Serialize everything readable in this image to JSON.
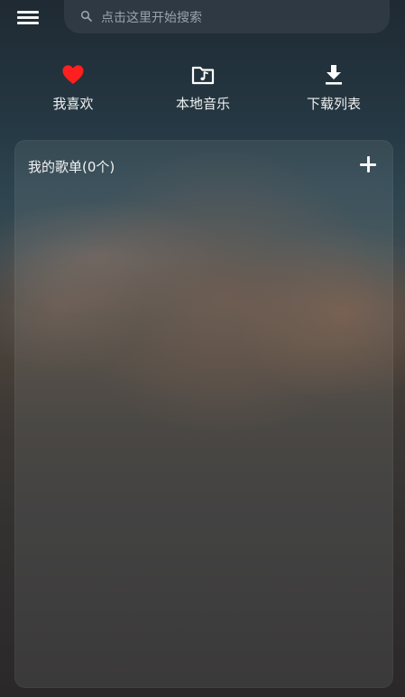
{
  "search": {
    "placeholder": "点击这里开始搜索",
    "icon": "search-icon"
  },
  "menu": {
    "icon": "hamburger-menu-icon"
  },
  "quick_links": [
    {
      "label": "我喜欢",
      "icon": "heart-icon",
      "color": "#ff1f1f"
    },
    {
      "label": "本地音乐",
      "icon": "music-folder-icon",
      "color": "#ffffff"
    },
    {
      "label": "下载列表",
      "icon": "download-icon",
      "color": "#ffffff"
    }
  ],
  "playlists": {
    "title": "我的歌单(0个)",
    "add_icon": "plus-icon"
  }
}
